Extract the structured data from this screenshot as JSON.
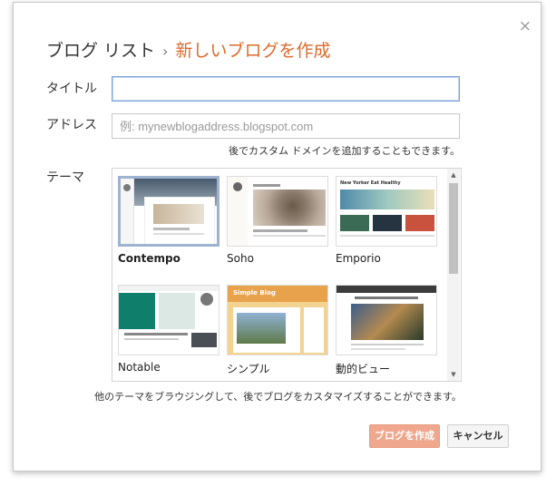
{
  "dialog": {
    "breadcrumb_parent": "ブログ リスト",
    "breadcrumb_separator": "›",
    "breadcrumb_current": "新しいブログを作成",
    "close_icon": "×"
  },
  "form": {
    "title_label": "タイトル",
    "title_value": "",
    "address_label": "アドレス",
    "address_placeholder": "例: mynewblogaddress.blogspot.com",
    "address_hint": "後でカスタム ドメインを追加することもできます。",
    "theme_label": "テーマ"
  },
  "themes": [
    {
      "name": "Contempo",
      "selected": true
    },
    {
      "name": "Soho",
      "selected": false
    },
    {
      "name": "Emporio",
      "selected": false
    },
    {
      "name": "Notable",
      "selected": false
    },
    {
      "name": "シンプル",
      "selected": false
    },
    {
      "name": "動的ビュー",
      "selected": false
    }
  ],
  "thumb_text": {
    "emporio_heading": "New Yorker Eat Healthy",
    "simple_heading": "Simple Blog"
  },
  "footer": {
    "note": "他のテーマをブラウジングして、後でブログをカスタマイズすることができます。",
    "create_button": "ブログを作成",
    "cancel_button": "キャンセル"
  },
  "colors": {
    "accent": "#dd6a2c",
    "primary_button": "#efa78d",
    "selected_border": "#9db3d0",
    "focus_border": "#7aa3d8"
  },
  "icons": {
    "close": "close-icon",
    "scroll_up": "chevron-up-icon",
    "scroll_down": "chevron-down-icon"
  }
}
